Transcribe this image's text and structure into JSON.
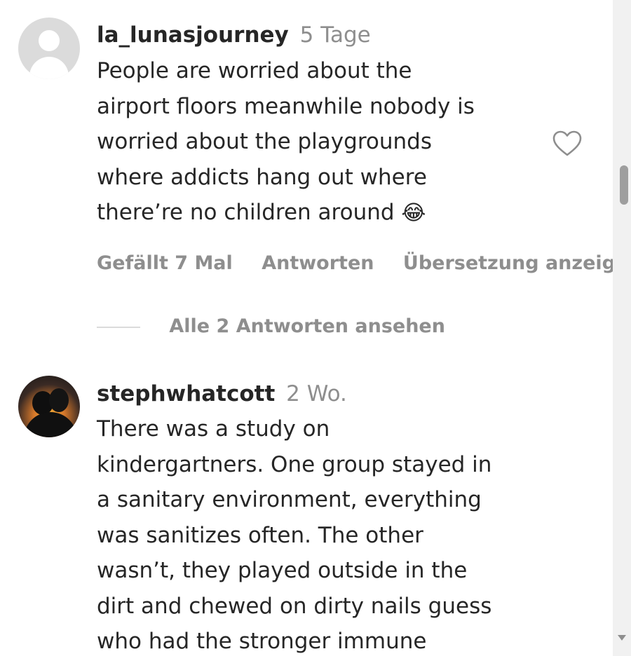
{
  "comments": [
    {
      "username": "la_lunasjourney",
      "time": "5 Tage",
      "text_lines": [
        "People are worried about the",
        "airport floors meanwhile nobody is",
        "worried about the playgrounds",
        "where addicts hang out where",
        "there’re no children around"
      ],
      "emoji": "😂",
      "likes_label": "Gefällt 7 Mal",
      "reply_label": "Antworten",
      "translate_label": "Übersetzung anzeige",
      "view_replies_label": "Alle 2 Antworten ansehen",
      "heart_icon": "heart-outline-icon"
    },
    {
      "username": "stephwhatcott",
      "time": "2 Wo.",
      "text_lines": [
        "There was a study on",
        "kindergartners. One group stayed in",
        "a sanitary environment, everything",
        "was sanitizes often. The other",
        "wasn’t, they played outside in the",
        "dirt and chewed on dirty nails guess",
        "who had the stronger immune"
      ]
    }
  ],
  "scrollbar": {
    "icons": [
      "scroll-thumb",
      "scroll-down-arrow-icon"
    ]
  }
}
